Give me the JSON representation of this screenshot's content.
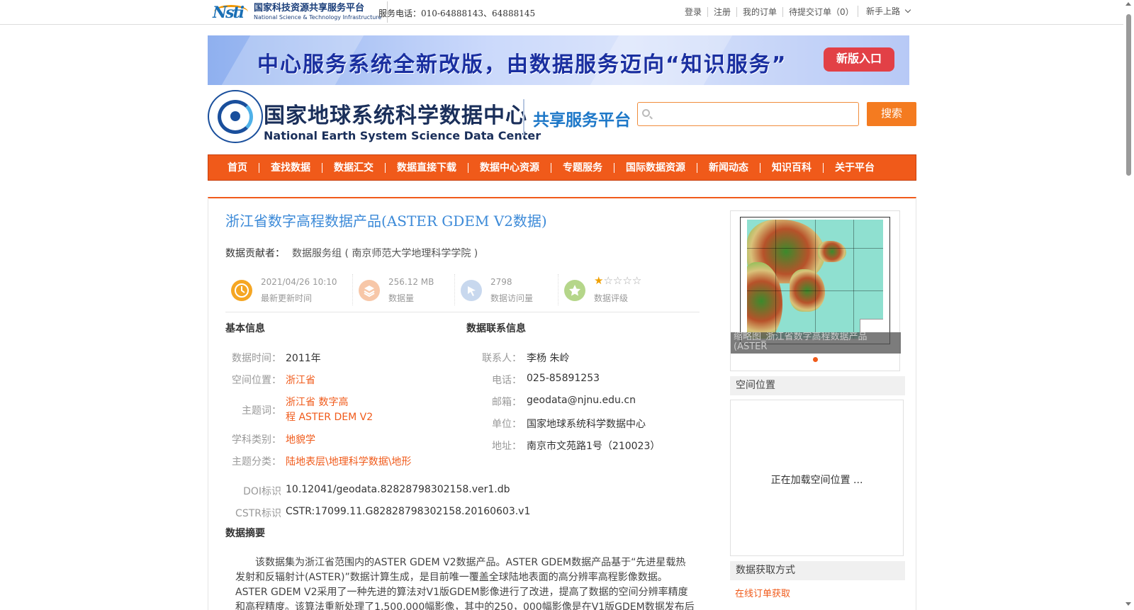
{
  "topbar": {
    "logo_cn": "国家科技资源共享服务平台",
    "logo_en": "National Science & Technology Infrastructure",
    "phone": "服务电话：010-64888143、64888145",
    "links": [
      "登录",
      "注册",
      "我的订单",
      "待提交订单（0）"
    ],
    "guide": "新手上路"
  },
  "banner": {
    "text": "中心服务系统全新改版，由数据服务迈向“知识服务”",
    "button": "新版入口"
  },
  "header": {
    "title_cn": "国家地球系统科学数据中心",
    "title_en": "National Earth System Science Data Center",
    "subtitle": "共享服务平台",
    "search_placeholder": "",
    "search_button": "搜索"
  },
  "nav": [
    "首页",
    "查找数据",
    "数据汇交",
    "数据直接下载",
    "数据中心资源",
    "专题服务",
    "国际数据资源",
    "新闻动态",
    "知识百科",
    "关于平台"
  ],
  "dataset": {
    "title": "浙江省数字高程数据产品(ASTER GDEM V2数据)",
    "contributor_label": "数据贡献者：",
    "contributor": "数据服务组 ( 南京师范大学地理科学学院 )",
    "stats": [
      {
        "value": "2021/04/26 10:10",
        "label": "最新更新时间",
        "icon": "clock-icon",
        "color": "#f5a623"
      },
      {
        "value": "256.12 MB",
        "label": "数据量",
        "icon": "layers-icon",
        "color": "#f7c7a8"
      },
      {
        "value": "2798",
        "label": "数据访问量",
        "icon": "cursor-icon",
        "color": "#c8d8ee"
      },
      {
        "value": "",
        "label": "数据评级",
        "icon": "star-badge-icon",
        "color": "#b5d68a"
      }
    ],
    "rating": 1,
    "rating_max": 5
  },
  "basic": {
    "heading": "基本信息",
    "time_label": "数据时间：",
    "time": "2011年",
    "location_label": "空间位置：",
    "location": "浙江省",
    "keywords_label": "主题词：",
    "keywords_line1": "浙江省 数字高",
    "keywords_line2": "程 ASTER DEM V2",
    "discipline_label": "学科类别：",
    "discipline": "地貌学",
    "category_label": "主题分类：",
    "category": "陆地表层\\地理科学数据\\地形",
    "doi_label": "DOI标识",
    "doi": "10.12041/geodata.82828798302158.ver1.db",
    "cstr_label": "CSTR标识",
    "cstr": "CSTR:17099.11.G82828798302158.20160603.v1"
  },
  "contact": {
    "heading": "数据联系信息",
    "person_label": "联系人：",
    "person": "李杨 朱岭",
    "phone_label": "电话：",
    "phone": "025-85891253",
    "email_label": "邮箱：",
    "email": "geodata@njnu.edu.cn",
    "org_label": "单位：",
    "org": "国家地球系统科学数据中心",
    "addr_label": "地址：",
    "addr": "南京市文苑路1号（210023）"
  },
  "abstract": {
    "heading": "数据摘要",
    "text": "该数据集为浙江省范围内的ASTER GDEM V2数据产品。ASTER GDEM数据产品基于“先进星载热发射和反辐射计(ASTER)”数据计算生成，是目前唯一覆盖全球陆地表面的高分辨率高程影像数据。ASTER GDEM V2采用了一种先进的算法对V1版GDEM影像进行了改进，提高了数据的空间分辨率精度和高程精度。该算法重新处理了1,500,000幅影像，其中的250，000幅影像是在V1版GDEM数据发布后新获取的影"
  },
  "sidebar": {
    "thumb_caption_1": "缩略图_浙江省数字高程数据产品",
    "thumb_caption_2": "(ASTER",
    "spatial_heading": "空间位置",
    "spatial_loading": "正在加载空间位置 ...",
    "access_heading": "数据获取方式",
    "access_link": "在线订单获取"
  }
}
